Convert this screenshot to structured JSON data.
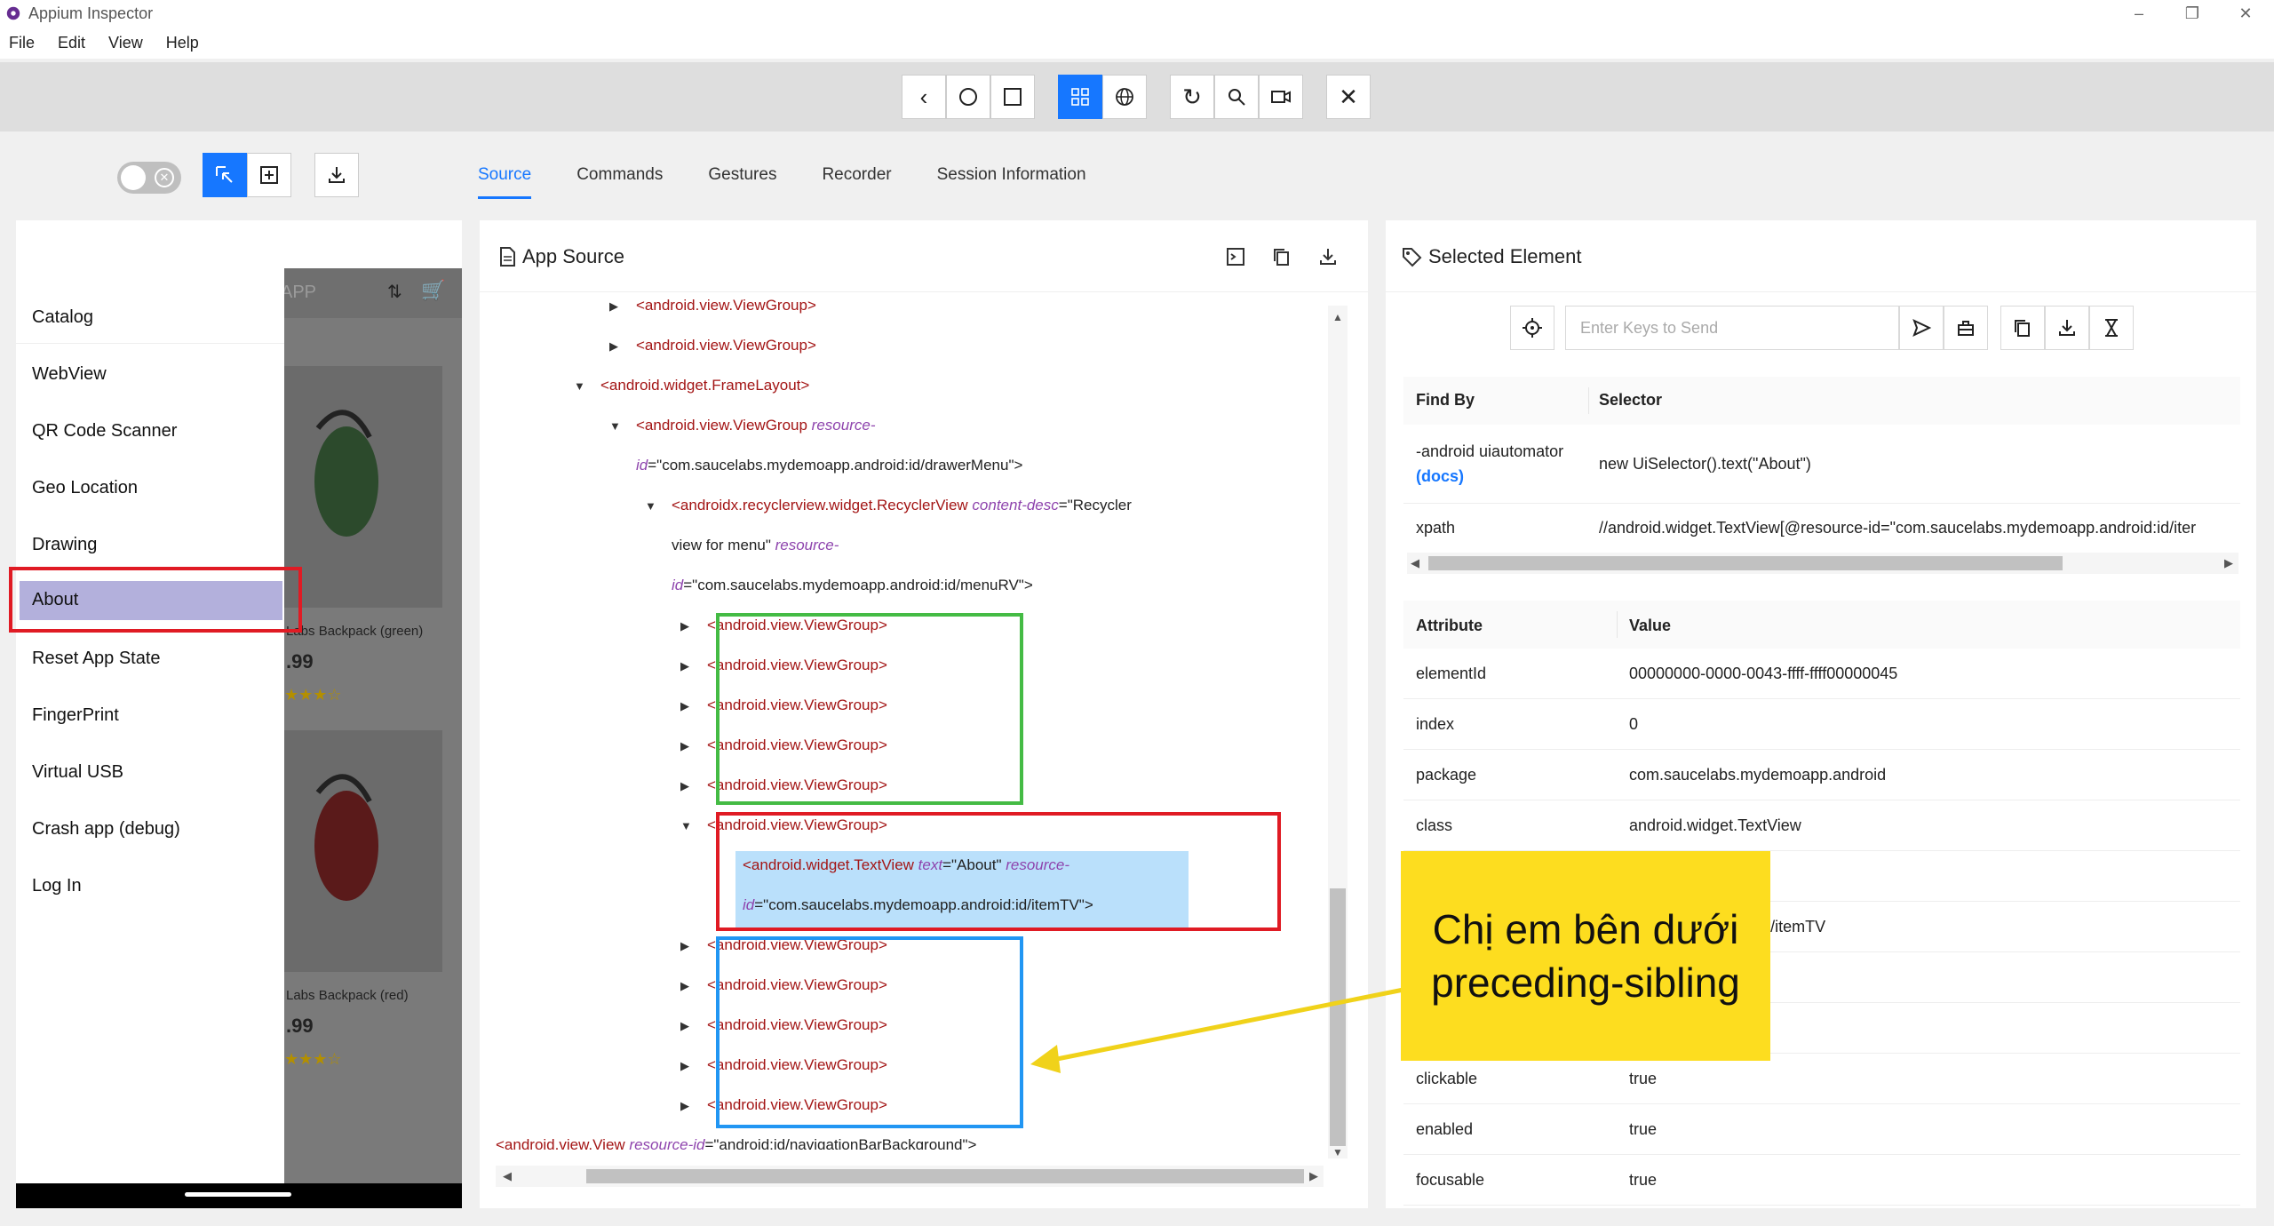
{
  "window": {
    "title": "Appium Inspector"
  },
  "menu": [
    "File",
    "Edit",
    "View",
    "Help"
  ],
  "tabs": [
    "Source",
    "Commands",
    "Gestures",
    "Recorder",
    "Session Information"
  ],
  "device": {
    "drawer_items": [
      "Catalog",
      "WebView",
      "QR Code Scanner",
      "Geo Location",
      "Drawing",
      "About",
      "Reset App State",
      "FingerPrint",
      "Virtual USB",
      "Crash app (debug)",
      "Log In"
    ],
    "selected_item": "About",
    "header_text": "APP",
    "products": [
      {
        "name": "Labs Backpack (green)",
        "price": ".99"
      },
      {
        "name": "Labs Backpack (red)",
        "price": ".99"
      }
    ]
  },
  "source": {
    "title": "App Source",
    "lines": [
      {
        "indent": 3,
        "arrow": "right",
        "tag": "<android.view.ViewGroup>"
      },
      {
        "indent": 3,
        "arrow": "right",
        "tag": "<android.view.ViewGroup>"
      },
      {
        "indent": 2,
        "arrow": "down",
        "tag": "<android.widget.FrameLayout>"
      },
      {
        "indent": 3,
        "arrow": "down",
        "tag": "<android.view.ViewGroup",
        "attrs": [
          [
            "resource-",
            ""
          ]
        ]
      },
      {
        "indent": 3,
        "arrow": "",
        "cont": true,
        "attrs": [
          [
            "id",
            "=\"com.saucelabs.mydemoapp.android:id/drawerMenu\">"
          ]
        ]
      },
      {
        "indent": 4,
        "arrow": "down",
        "tag": "<androidx.recyclerview.widget.RecyclerView",
        "attrs": [
          [
            "content-desc",
            "=\"Recycler"
          ]
        ]
      },
      {
        "indent": 4,
        "arrow": "",
        "cont": true,
        "text": "view for menu\"",
        "attrs": [
          [
            "resource-",
            ""
          ]
        ]
      },
      {
        "indent": 4,
        "arrow": "",
        "cont": true,
        "attrs": [
          [
            "id",
            "=\"com.saucelabs.mydemoapp.android:id/menuRV\">"
          ]
        ]
      },
      {
        "indent": 5,
        "arrow": "right",
        "tag": "<android.view.ViewGroup>"
      },
      {
        "indent": 5,
        "arrow": "right",
        "tag": "<android.view.ViewGroup>"
      },
      {
        "indent": 5,
        "arrow": "right",
        "tag": "<android.view.ViewGroup>"
      },
      {
        "indent": 5,
        "arrow": "right",
        "tag": "<android.view.ViewGroup>"
      },
      {
        "indent": 5,
        "arrow": "right",
        "tag": "<android.view.ViewGroup>"
      },
      {
        "indent": 5,
        "arrow": "down",
        "tag": "<android.view.ViewGroup>"
      },
      {
        "indent": 6,
        "arrow": "",
        "hl": true,
        "tag": "<android.widget.TextView",
        "attrs": [
          [
            "text",
            "=\"About\""
          ],
          [
            "resource-",
            ""
          ]
        ]
      },
      {
        "indent": 6,
        "arrow": "",
        "hl": true,
        "cont": true,
        "attrs": [
          [
            "id",
            "=\"com.saucelabs.mydemoapp.android:id/itemTV\">"
          ]
        ]
      },
      {
        "indent": 5,
        "arrow": "right",
        "tag": "<android.view.ViewGroup>"
      },
      {
        "indent": 5,
        "arrow": "right",
        "tag": "<android.view.ViewGroup>"
      },
      {
        "indent": 5,
        "arrow": "right",
        "tag": "<android.view.ViewGroup>"
      },
      {
        "indent": 5,
        "arrow": "right",
        "tag": "<android.view.ViewGroup>"
      },
      {
        "indent": 5,
        "arrow": "right",
        "tag": "<android.view.ViewGroup>"
      },
      {
        "indent": 0,
        "arrow": "",
        "tag": "<android.view.View",
        "attrs": [
          [
            "resource-id",
            "=\"android:id/navigationBarBackground\">"
          ]
        ]
      }
    ]
  },
  "selected": {
    "title": "Selected Element",
    "keys_placeholder": "Enter Keys to Send",
    "find_by_header": "Find By",
    "selector_header": "Selector",
    "find_rows": [
      {
        "by": "-android uiautomator",
        "docs": "(docs)",
        "selector": "new UiSelector().text(\"About\")"
      },
      {
        "by": "xpath",
        "selector": "//android.widget.TextView[@resource-id=\"com.saucelabs.mydemoapp.android:id/iter"
      }
    ],
    "attr_header": "Attribute",
    "value_header": "Value",
    "attributes": [
      {
        "name": "elementId",
        "value": "00000000-0000-0043-ffff-ffff00000045"
      },
      {
        "name": "index",
        "value": "0"
      },
      {
        "name": "package",
        "value": "com.saucelabs.mydemoapp.android"
      },
      {
        "name": "class",
        "value": "android.widget.TextView"
      },
      {
        "name": "",
        "value": ""
      },
      {
        "name": "",
        "value": "demoapp.android:id/itemTV"
      },
      {
        "name": "",
        "value": ""
      },
      {
        "name": "",
        "value": ""
      },
      {
        "name": "clickable",
        "value": "true"
      },
      {
        "name": "enabled",
        "value": "true"
      },
      {
        "name": "focusable",
        "value": "true"
      }
    ]
  },
  "annotation": {
    "callout": "Chị em bên dưới preceding-sibling"
  },
  "colors": {
    "accent": "#1677ff",
    "red_box": "#e01b24",
    "green_box": "#44bb44",
    "blue_box": "#2196f3",
    "callout": "#fddd1f"
  }
}
